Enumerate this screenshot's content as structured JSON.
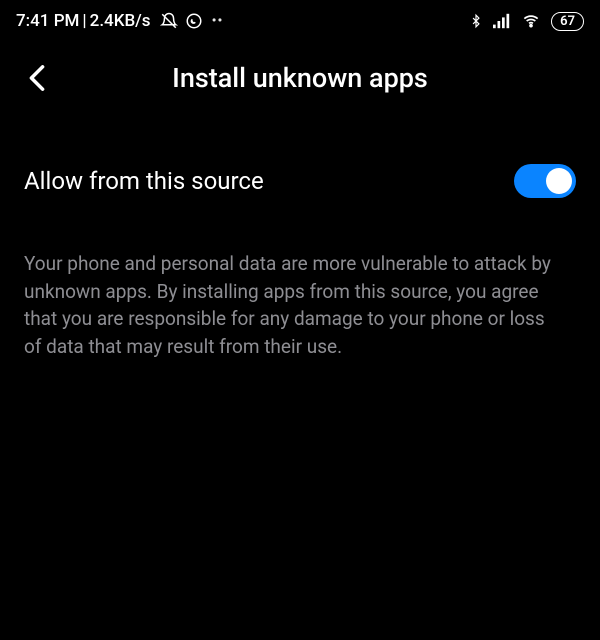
{
  "statusbar": {
    "time": "7:41 PM",
    "separator": " | ",
    "data_rate": "2.4KB/s",
    "battery": "67"
  },
  "header": {
    "title": "Install unknown apps"
  },
  "setting": {
    "label": "Allow from this source",
    "enabled": true
  },
  "description": "Your phone and personal data are more vulnerable to attack by unknown apps. By installing apps from this source, you agree that you are responsible for any damage to your phone or loss of data that may result from their use."
}
